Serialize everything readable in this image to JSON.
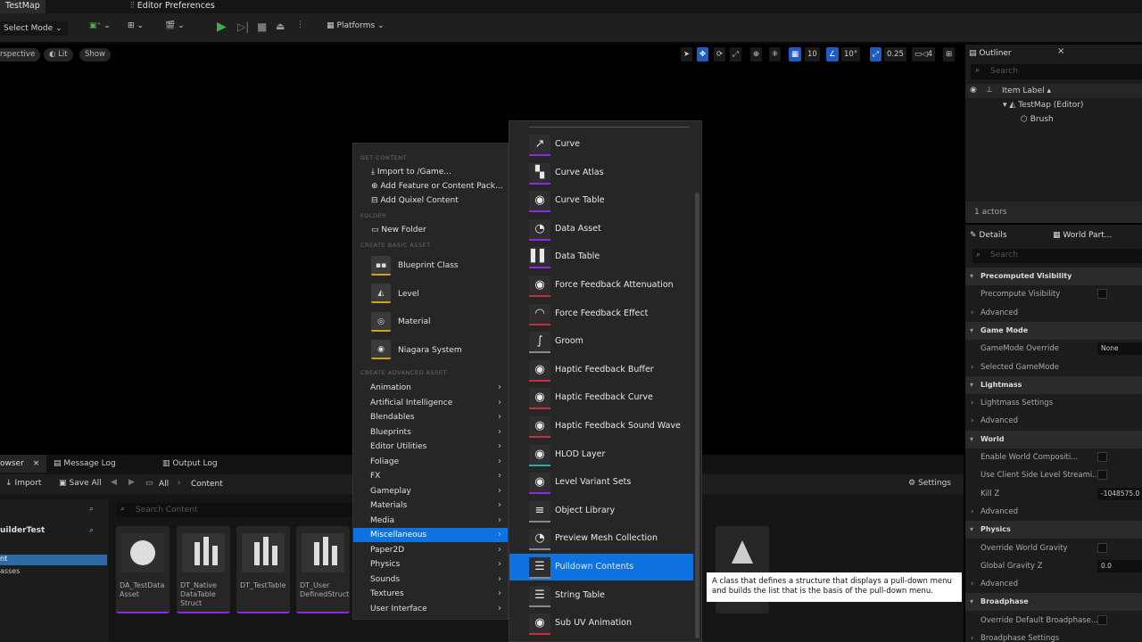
{
  "top_tabs": {
    "map": "TestMap",
    "prefs": "Editor Preferences"
  },
  "toolbar": {
    "select_mode": "Select Mode",
    "platforms": "Platforms"
  },
  "viewport": {
    "perspective": "rspective",
    "lit": "Lit",
    "show": "Show",
    "grid_snap": "10",
    "rot_snap": "10°",
    "scale_snap": "0.25",
    "cam_speed": "4"
  },
  "outliner": {
    "title": "Outliner",
    "search_placeholder": "Search",
    "column": "Item Label",
    "items": [
      "TestMap (Editor)",
      "Brush"
    ],
    "actors_count": "1 actors"
  },
  "details": {
    "tab1": "Details",
    "tab2": "World Part...",
    "search_placeholder": "Search",
    "rows": [
      {
        "type": "section",
        "label": "Precomputed Visibility"
      },
      {
        "type": "check",
        "label": "Precompute Visibility"
      },
      {
        "type": "sub",
        "label": "Advanced"
      },
      {
        "type": "section",
        "label": "Game Mode"
      },
      {
        "type": "value",
        "label": "GameMode Override",
        "value": "None"
      },
      {
        "type": "sub",
        "label": "Selected GameMode"
      },
      {
        "type": "section",
        "label": "Lightmass"
      },
      {
        "type": "sub",
        "label": "Lightmass Settings"
      },
      {
        "type": "sub",
        "label": "Advanced"
      },
      {
        "type": "section",
        "label": "World"
      },
      {
        "type": "check",
        "label": "Enable World Compositi..."
      },
      {
        "type": "check",
        "label": "Use Client Side Level Streami..."
      },
      {
        "type": "value",
        "label": "Kill Z",
        "value": "-1048575.0"
      },
      {
        "type": "sub",
        "label": "Advanced"
      },
      {
        "type": "section",
        "label": "Physics"
      },
      {
        "type": "check",
        "label": "Override World Gravity"
      },
      {
        "type": "value",
        "label": "Global Gravity Z",
        "value": "0.0"
      },
      {
        "type": "sub",
        "label": "Advanced"
      },
      {
        "type": "section",
        "label": "Broadphase"
      },
      {
        "type": "check",
        "label": "Override Default Broadphase..."
      },
      {
        "type": "sub",
        "label": "Broadphase Settings"
      }
    ]
  },
  "bottom": {
    "tab_browser": "owser",
    "tab_msglog": "Message Log",
    "tab_outputlog": "Output Log",
    "import": "Import",
    "save_all": "Save All",
    "path": [
      "All",
      "Content"
    ],
    "settings": "Settings",
    "search_placeholder": "Search Content",
    "tree_root": "uilderTest",
    "tree_items": [
      "nt",
      "asses"
    ],
    "assets": [
      "DA_TestData Asset",
      "DT_Native DataTable Struct",
      "DT_TestTable",
      "DT_User DefinedStruct"
    ]
  },
  "left_menu": {
    "h_get": "GET CONTENT",
    "get": [
      "Import to /Game...",
      "Add Feature or Content Pack...",
      "Add Quixel Content"
    ],
    "h_folder": "FOLDER",
    "folder": "New Folder",
    "h_basic": "CREATE BASIC ASSET",
    "basic": [
      "Blueprint Class",
      "Level",
      "Material",
      "Niagara System"
    ],
    "h_adv": "CREATE ADVANCED ASSET",
    "adv": [
      "Animation",
      "Artificial Intelligence",
      "Blendables",
      "Blueprints",
      "Editor Utilities",
      "Foliage",
      "FX",
      "Gameplay",
      "Materials",
      "Media",
      "Miscellaneous",
      "Paper2D",
      "Physics",
      "Sounds",
      "Textures",
      "User Interface"
    ]
  },
  "right_menu": [
    {
      "label": "Curve",
      "icon": "curve-icon",
      "color": "#8a2be2"
    },
    {
      "label": "Curve Atlas",
      "icon": "checker-icon",
      "color": "#8a2be2"
    },
    {
      "label": "Curve Table",
      "icon": "sphere-icon",
      "color": "#8a2be2"
    },
    {
      "label": "Data Asset",
      "icon": "pie-icon",
      "color": "#8a2be2"
    },
    {
      "label": "Data Table",
      "icon": "bars-icon",
      "color": "#8a2be2"
    },
    {
      "label": "Force Feedback Attenuation",
      "icon": "sphere-icon",
      "color": "#c0303a"
    },
    {
      "label": "Force Feedback Effect",
      "icon": "gamepad-icon",
      "color": "#c0303a"
    },
    {
      "label": "Groom",
      "icon": "hair-icon",
      "color": "#888888"
    },
    {
      "label": "Haptic Feedback Buffer",
      "icon": "sphere-icon",
      "color": "#c0303a"
    },
    {
      "label": "Haptic Feedback Curve",
      "icon": "sphere-icon",
      "color": "#c0303a"
    },
    {
      "label": "Haptic Feedback Sound Wave",
      "icon": "sphere-icon",
      "color": "#c0303a"
    },
    {
      "label": "HLOD Layer",
      "icon": "sphere-icon",
      "color": "#20b2aa"
    },
    {
      "label": "Level Variant Sets",
      "icon": "sphere-icon",
      "color": "#8a2be2"
    },
    {
      "label": "Object Library",
      "icon": "stack-icon",
      "color": "#888888"
    },
    {
      "label": "Preview Mesh Collection",
      "icon": "pie-icon",
      "color": "#888888"
    },
    {
      "label": "Pulldown Contents",
      "icon": "list-icon",
      "color": "#888888"
    },
    {
      "label": "String Table",
      "icon": "list-icon",
      "color": "#888888"
    },
    {
      "label": "Sub UV Animation",
      "icon": "sphere-icon",
      "color": "#c0303a"
    }
  ],
  "tooltip": "A class that defines a structure that displays a pull-down menu and builds the list that is the basis of the pull-down menu.",
  "colors": {
    "accent": "#0e72e0",
    "viewport_bg": "#000000",
    "menu_bg": "#262626"
  }
}
